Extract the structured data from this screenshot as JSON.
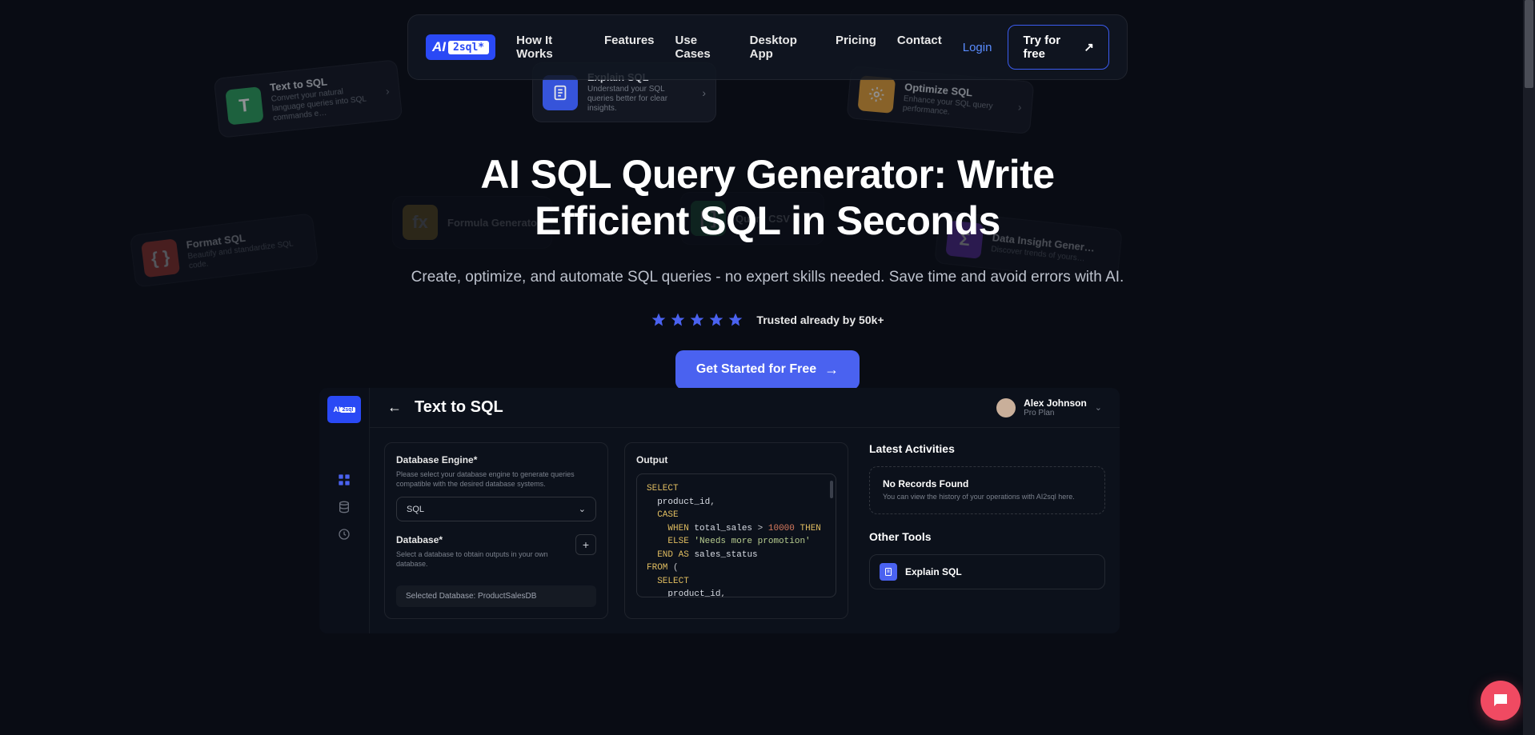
{
  "logo": {
    "ai": "AI",
    "sql": "2sql*"
  },
  "nav": {
    "how": "How It Works",
    "features": "Features",
    "usecases": "Use Cases",
    "desktop": "Desktop App",
    "pricing": "Pricing",
    "contact": "Contact",
    "login": "Login",
    "try": "Try for free"
  },
  "hero": {
    "title": "AI SQL Query Generator: Write Efficient SQL in Seconds",
    "subtitle": "Create, optimize, and automate SQL queries - no expert skills needed. Save time and avoid errors with AI.",
    "trusted": "Trusted already by 50k+",
    "cta": "Get Started for Free"
  },
  "floats": {
    "text_to_sql": {
      "title": "Text to SQL",
      "desc": "Convert your natural language queries into SQL commands e…"
    },
    "explain_sql": {
      "title": "Explain SQL",
      "desc": "Understand your SQL queries better for clear insights."
    },
    "optimize_sql": {
      "title": "Optimize SQL",
      "desc": "Enhance your SQL query performance."
    },
    "format_sql": {
      "title": "Format SQL",
      "desc": "Beautify and standardize SQL code."
    },
    "formula_gen": {
      "title": "Formula Generator",
      "desc": "…"
    },
    "query_csv": {
      "title": "Query CSV",
      "desc": "…"
    },
    "data_insight": {
      "title": "Data Insight Gener…",
      "desc": "Discover trends of yours…"
    }
  },
  "app": {
    "header": {
      "title": "Text to SQL",
      "user_name": "Alex Johnson",
      "user_plan": "Pro Plan"
    },
    "form": {
      "engine_label": "Database Engine*",
      "engine_hint": "Please select your database engine to generate queries compatible with the desired database systems.",
      "engine_value": "SQL",
      "db_label": "Database*",
      "db_hint": "Select a database to obtain outputs in your own database.",
      "selected_db": "Selected Database: ProductSalesDB"
    },
    "output": {
      "label": "Output",
      "code_html": "<span class='kw'>SELECT</span><br>&nbsp;&nbsp;<span class='ident'>product_id</span><span class='op'>,</span><br>&nbsp;&nbsp;<span class='kw'>CASE</span><br>&nbsp;&nbsp;&nbsp;&nbsp;<span class='kw'>WHEN</span> <span class='ident'>total_sales</span> <span class='op'>&gt;</span> <span class='num'>10000</span> <span class='kw'>THEN</span><br>&nbsp;&nbsp;&nbsp;&nbsp;<span class='kw'>ELSE</span> <span class='str'>'Needs more promotion'</span><br>&nbsp;&nbsp;<span class='kw'>END</span> <span class='kw'>AS</span> <span class='ident'>sales_status</span><br><span class='kw'>FROM</span> <span class='op'>(</span><br>&nbsp;&nbsp;<span class='kw'>SELECT</span><br>&nbsp;&nbsp;&nbsp;&nbsp;<span class='ident'>product_id</span><span class='op'>,</span><br>&nbsp;&nbsp;&nbsp;&nbsp;<span class='kw'>SUM</span><span class='op'>(</span><span class='ident'>quantity</span> <span class='op'>*</span> <span class='ident'>price</span><span class='op'>)</span> <span class='kw'>AS</span> <span class='ident'>tota</span>"
    },
    "right": {
      "latest": "Latest Activities",
      "no_records_title": "No Records Found",
      "no_records_desc": "You can view the history of your operations with AI2sql here.",
      "other_tools": "Other Tools",
      "tool1": "Explain SQL"
    }
  }
}
